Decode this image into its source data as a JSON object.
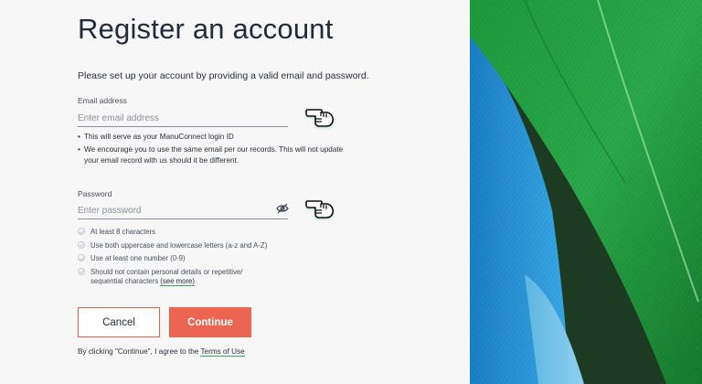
{
  "page": {
    "title": "Register an account",
    "intro": "Please set up your account by providing a valid email and password."
  },
  "email": {
    "label": "Email address",
    "placeholder": "Enter email address",
    "notes": [
      "This will serve as your ManuConnect login ID",
      "We encourage you to use the same email per our records. This will not update your email record with us should it be different."
    ]
  },
  "password": {
    "label": "Password",
    "placeholder": "Enter password",
    "rules": [
      "At least 8 characters",
      "Use both uppercase and lowercase letters (a-z and A-Z)",
      "Use at least one number (0-9)",
      "Should not contain personal details or repetitive/ sequential characters"
    ],
    "see_more": "(see more)"
  },
  "buttons": {
    "cancel": "Cancel",
    "continue": "Continue"
  },
  "terms": {
    "text": "By clicking \"Continue\", I agree to the ",
    "link": "Terms of Use"
  },
  "colors": {
    "accent": "#ec6553",
    "link_underline": "#3ba36b",
    "hand_glow": "#1fa35a"
  },
  "icons": {
    "pointer_hand": "pointing-hand-icon",
    "password_visibility": "eye-slash-icon"
  }
}
